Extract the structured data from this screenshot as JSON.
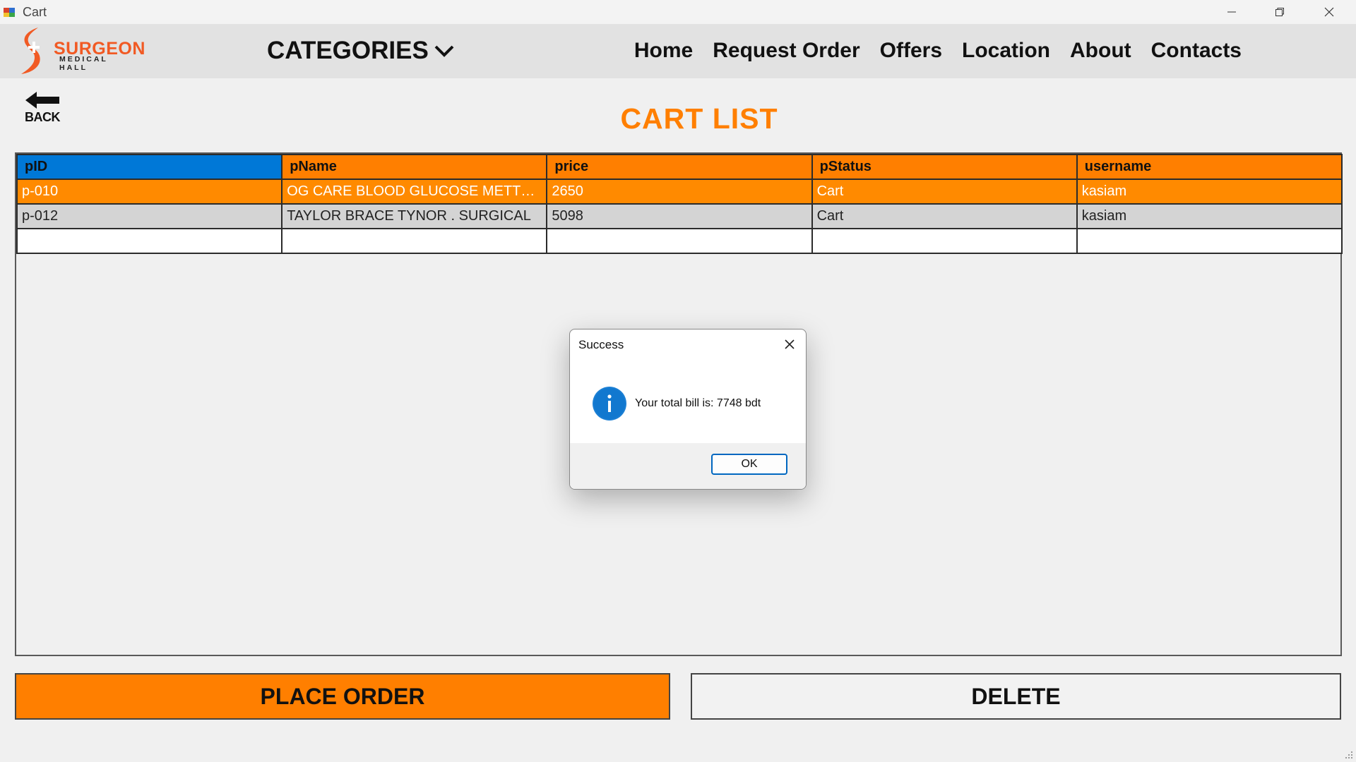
{
  "window": {
    "title": "Cart"
  },
  "brand": {
    "name": "SURGEON",
    "subtitle": "MEDICAL HALL",
    "accent": "#ff7f00",
    "logo_red": "#f15a24"
  },
  "nav": {
    "categories": "CATEGORIES",
    "links": [
      "Home",
      "Request Order",
      "Offers",
      "Location",
      "About",
      "Contacts"
    ]
  },
  "back_label": "BACK",
  "page_title": "CART LIST",
  "table": {
    "columns": [
      "pID",
      "pName",
      "price",
      "pStatus",
      "username"
    ],
    "rows": [
      [
        "p-010",
        "OG CARE BLOOD GLUCOSE METTER ...",
        "2650",
        "Cart",
        "kasiam"
      ],
      [
        "p-012",
        "TAYLOR BRACE TYNOR . SURGICAL",
        "5098",
        "Cart",
        "kasiam"
      ],
      [
        "",
        "",
        "",
        "",
        ""
      ]
    ]
  },
  "buttons": {
    "place_order": "PLACE ORDER",
    "delete": "DELETE"
  },
  "dialog": {
    "title": "Success",
    "message": "Your total bill is: 7748 bdt",
    "ok": "OK",
    "icon": "info-icon"
  }
}
